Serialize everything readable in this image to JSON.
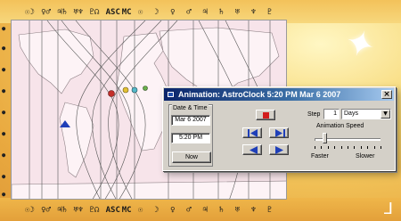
{
  "dialog": {
    "title": "Animation: AstroClock   5:20 PM Mar 6 2007",
    "close_glyph": "×",
    "date_time_legend": "Date & Time",
    "date_value": "Mar 6 2007",
    "time_value": "5:20 PM",
    "now_label": "Now",
    "step_label": "Step",
    "step_value": "1",
    "step_unit": "Days",
    "speed_label": "Animation Speed",
    "speed_level": 0.15,
    "faster_label": "Faster",
    "slower_label": "Slower",
    "controls": [
      "stop",
      "skip-back",
      "skip-forward",
      "play-back",
      "play-forward"
    ],
    "stop_color": "#d21d1d",
    "control_arrow_color": "#1f3fb8"
  },
  "map": {
    "land_color": "#fbeef2",
    "line_color": "#555555",
    "top_glyphs": [
      "☉☽",
      "♀♂",
      "♃♄",
      "♅♆",
      "♇☊",
      "ASC",
      "MC",
      "☉",
      "☽",
      "♀",
      "♂",
      "♃",
      "♄",
      "♅",
      "♆",
      "♇"
    ],
    "bottom_glyphs": [
      "☉☽",
      "♀♂",
      "♃♄",
      "♅♆",
      "♇☊",
      "ASC",
      "MC",
      "☉",
      "☽",
      "♀",
      "♂",
      "♃",
      "♄",
      "♅",
      "♆",
      "♇"
    ]
  },
  "decor": {
    "sparkle_glyph": "✦",
    "small_sparkle_glyph": "ᒧ"
  }
}
